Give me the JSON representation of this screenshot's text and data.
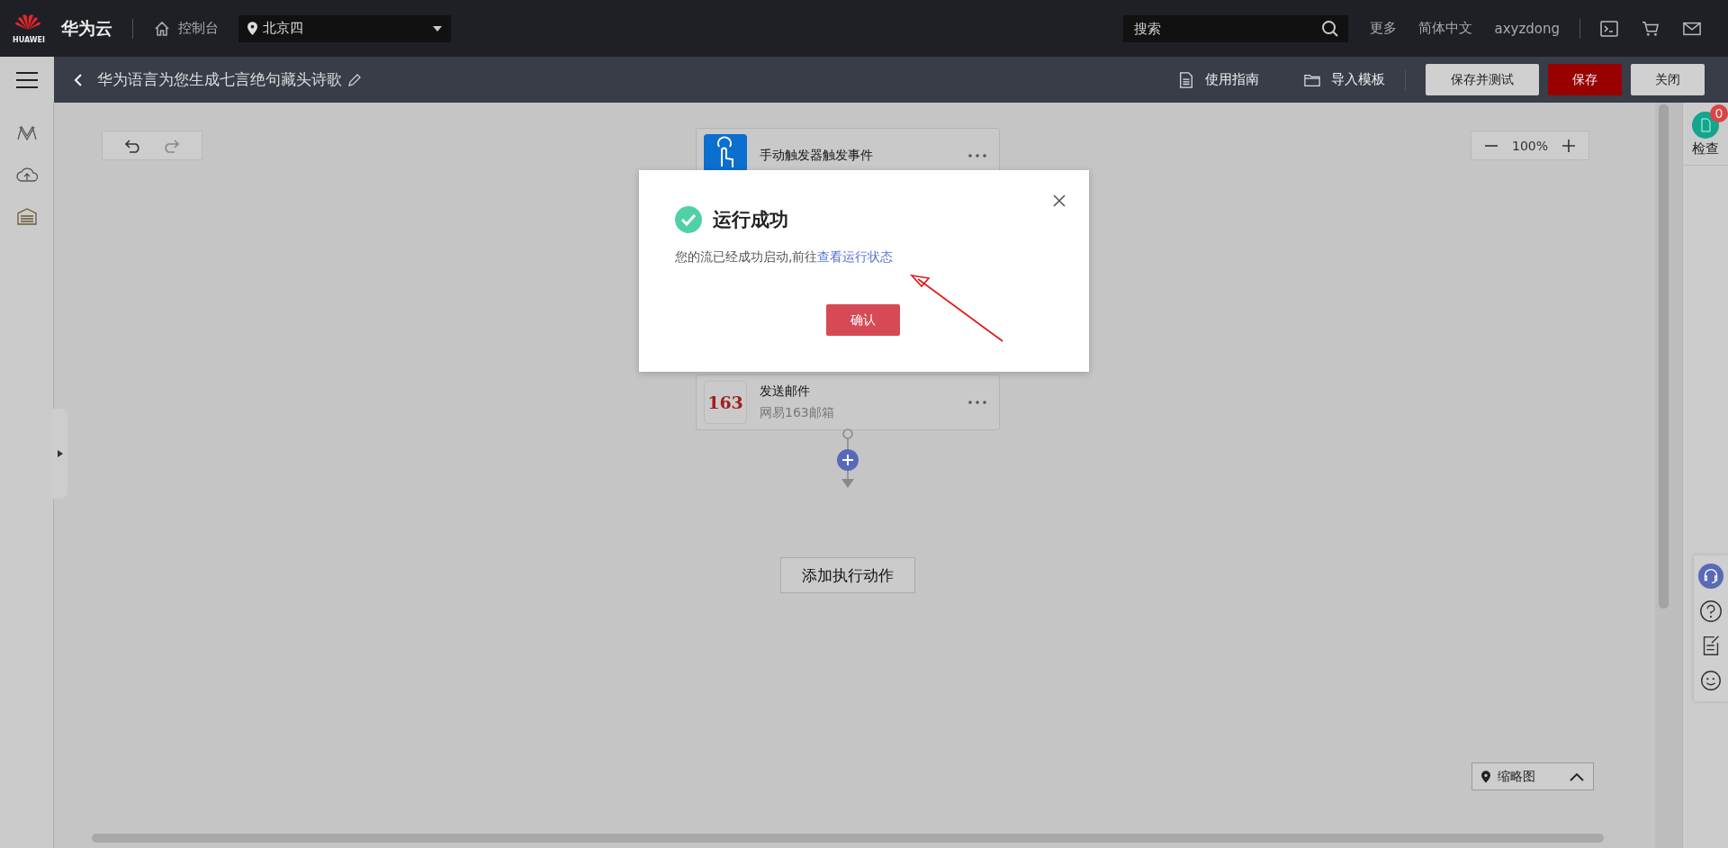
{
  "header": {
    "logo_text": "HUAWEI",
    "brand": "华为云",
    "console": "控制台",
    "region": "北京四",
    "search": {
      "placeholder": "搜索"
    },
    "links": [
      "更多",
      "简体中文",
      "axyzdong"
    ]
  },
  "toolbar": {
    "title": "华为语言为您生成七言绝句藏头诗歌",
    "guide": "使用指南",
    "import": "导入模板",
    "buttons": [
      {
        "label": "保存并测试",
        "kind": "default"
      },
      {
        "label": "保存",
        "kind": "primary"
      },
      {
        "label": "关闭",
        "kind": "default"
      }
    ]
  },
  "canvas": {
    "zoom": "100%",
    "nodes": [
      {
        "kind": "trigger",
        "title": "手动触发器触发事件"
      },
      {
        "kind": "mail",
        "icon_text": "163",
        "title": "发送邮件",
        "subtitle": "网易163邮箱"
      }
    ],
    "add_action": "添加执行动作",
    "thumbnail": "缩略图"
  },
  "right_panel": {
    "check": "检查",
    "badge": "0"
  },
  "dialog": {
    "title": "运行成功",
    "message": "您的流已经成功启动,前往",
    "link": "查看运行状态",
    "confirm": "确认"
  }
}
